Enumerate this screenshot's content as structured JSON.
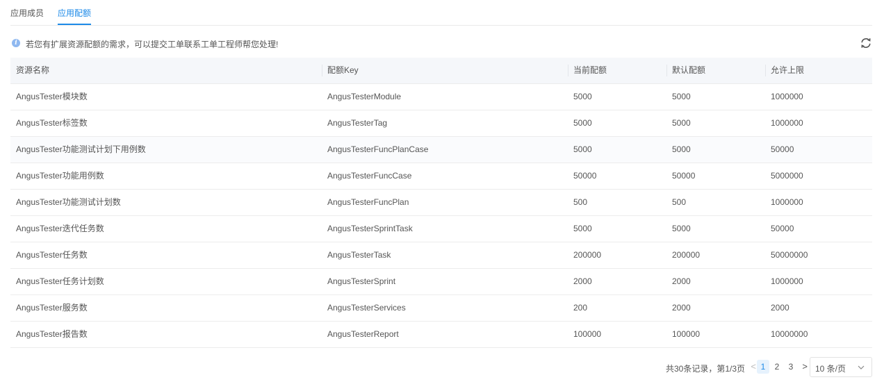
{
  "tabs": [
    {
      "label": "应用成员"
    },
    {
      "label": "应用配额"
    }
  ],
  "notice": {
    "icon": "info-icon",
    "text": "若您有扩展资源配额的需求，可以提交工单联系工单工程师帮您处理!"
  },
  "table": {
    "headers": [
      "资源名称",
      "配额Key",
      "当前配额",
      "默认配额",
      "允许上限"
    ],
    "rows": [
      [
        "AngusTester模块数",
        "AngusTesterModule",
        "5000",
        "5000",
        "1000000"
      ],
      [
        "AngusTester标签数",
        "AngusTesterTag",
        "5000",
        "5000",
        "1000000"
      ],
      [
        "AngusTester功能测试计划下用例数",
        "AngusTesterFuncPlanCase",
        "5000",
        "5000",
        "50000"
      ],
      [
        "AngusTester功能用例数",
        "AngusTesterFuncCase",
        "50000",
        "50000",
        "5000000"
      ],
      [
        "AngusTester功能测试计划数",
        "AngusTesterFuncPlan",
        "500",
        "500",
        "1000000"
      ],
      [
        "AngusTester迭代任务数",
        "AngusTesterSprintTask",
        "5000",
        "5000",
        "50000"
      ],
      [
        "AngusTester任务数",
        "AngusTesterTask",
        "200000",
        "200000",
        "50000000"
      ],
      [
        "AngusTester任务计划数",
        "AngusTesterSprint",
        "2000",
        "2000",
        "1000000"
      ],
      [
        "AngusTester服务数",
        "AngusTesterServices",
        "200",
        "2000",
        "2000"
      ],
      [
        "AngusTester报告数",
        "AngusTesterReport",
        "100000",
        "100000",
        "10000000"
      ]
    ]
  },
  "pagination": {
    "total_text": "共30条记录，第1/3页",
    "prev": "<",
    "pages": [
      "1",
      "2",
      "3"
    ],
    "next": ">",
    "page_size": "10 条/页"
  },
  "colors": {
    "accent": "#1d8ae8",
    "header_bg": "#f5f7fa"
  }
}
